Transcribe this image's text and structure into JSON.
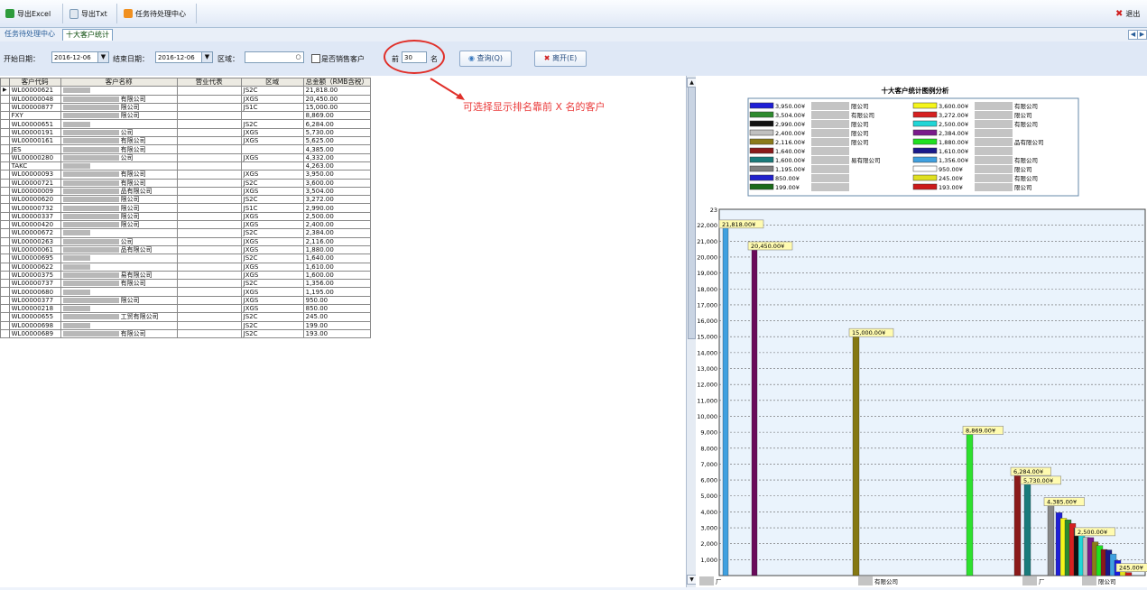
{
  "toolbar": {
    "export_excel": "导出Excel",
    "export_txt": "导出Txt",
    "task_center": "任务待处理中心",
    "exit": "退出"
  },
  "tabs": [
    {
      "label": "任务待处理中心"
    },
    {
      "label": "十大客户统计"
    }
  ],
  "filter": {
    "start_label": "开始日期：",
    "start_value": "2016-12-06",
    "end_label": "结束日期：",
    "end_value": "2016-12-06",
    "region_label": "区域：",
    "region_value": "",
    "checkbox_label": "是否销售客户",
    "top_label": "前",
    "top_value": "30",
    "top_suffix": "名",
    "query_button": "查询(Q)",
    "leave_button": "离开(E)"
  },
  "annotation": "可选择显示排名靠前 X 名的客户",
  "table": {
    "headers": [
      "客户代码",
      "客户名称",
      "营业代表",
      "区域",
      "总金额（RMB含税）"
    ],
    "rows": [
      {
        "code": "WL00000621",
        "name": "",
        "rep": "",
        "region": "JS2C",
        "total": "21,818.00"
      },
      {
        "code": "WL00000048",
        "name": "有限公司",
        "rep": "",
        "region": "JXGS",
        "total": "20,450.00"
      },
      {
        "code": "WL00000877",
        "name": "限公司",
        "rep": "",
        "region": "JS1C",
        "total": "15,000.00"
      },
      {
        "code": "FXY",
        "name": "限公司",
        "rep": "",
        "region": "",
        "total": "8,869.00"
      },
      {
        "code": "WL00000651",
        "name": "",
        "rep": "",
        "region": "JS2C",
        "total": "6,284.00"
      },
      {
        "code": "WL00000191",
        "name": "公司",
        "rep": "",
        "region": "JXGS",
        "total": "5,730.00"
      },
      {
        "code": "WL00000161",
        "name": "有限公司",
        "rep": "",
        "region": "JXGS",
        "total": "5,625.00"
      },
      {
        "code": "JES",
        "name": "有限公司",
        "rep": "",
        "region": "",
        "total": "4,385.00"
      },
      {
        "code": "WL00000280",
        "name": "公司",
        "rep": "",
        "region": "JXGS",
        "total": "4,332.00"
      },
      {
        "code": "TAKC",
        "name": "",
        "rep": "",
        "region": "",
        "total": "4,263.00"
      },
      {
        "code": "WL00000093",
        "name": "有限公司",
        "rep": "",
        "region": "JXGS",
        "total": "3,950.00"
      },
      {
        "code": "WL00000721",
        "name": "有限公司",
        "rep": "",
        "region": "JS2C",
        "total": "3,600.00"
      },
      {
        "code": "WL00000009",
        "name": "品有限公司",
        "rep": "",
        "region": "JXGS",
        "total": "3,504.00"
      },
      {
        "code": "WL00000620",
        "name": "限公司",
        "rep": "",
        "region": "JS2C",
        "total": "3,272.00"
      },
      {
        "code": "WL00000732",
        "name": "限公司",
        "rep": "",
        "region": "JS1C",
        "total": "2,990.00"
      },
      {
        "code": "WL00000337",
        "name": "限公司",
        "rep": "",
        "region": "JXGS",
        "total": "2,500.00"
      },
      {
        "code": "WL00000420",
        "name": "限公司",
        "rep": "",
        "region": "JXGS",
        "total": "2,400.00"
      },
      {
        "code": "WL00000672",
        "name": "",
        "rep": "",
        "region": "JS2C",
        "total": "2,384.00"
      },
      {
        "code": "WL00000263",
        "name": "公司",
        "rep": "",
        "region": "JXGS",
        "total": "2,116.00"
      },
      {
        "code": "WL00000061",
        "name": "品有限公司",
        "rep": "",
        "region": "JXGS",
        "total": "1,880.00"
      },
      {
        "code": "WL00000695",
        "name": "",
        "rep": "",
        "region": "JS2C",
        "total": "1,640.00"
      },
      {
        "code": "WL00000622",
        "name": "",
        "rep": "",
        "region": "JXGS",
        "total": "1,610.00"
      },
      {
        "code": "WL00000375",
        "name": "易有限公司",
        "rep": "",
        "region": "JXGS",
        "total": "1,600.00"
      },
      {
        "code": "WL00000737",
        "name": "有限公司",
        "rep": "",
        "region": "JS2C",
        "total": "1,356.00"
      },
      {
        "code": "WL00000680",
        "name": "",
        "rep": "",
        "region": "JXGS",
        "total": "1,195.00"
      },
      {
        "code": "WL00000377",
        "name": "限公司",
        "rep": "",
        "region": "JXGS",
        "total": "950.00"
      },
      {
        "code": "WL00000218",
        "name": "",
        "rep": "",
        "region": "JXGS",
        "total": "850.00"
      },
      {
        "code": "WL00000655",
        "name": "工贸有限公司",
        "rep": "",
        "region": "JS2C",
        "total": "245.00"
      },
      {
        "code": "WL00000698",
        "name": "",
        "rep": "",
        "region": "JS2C",
        "total": "199.00"
      },
      {
        "code": "WL00000689",
        "name": "有限公司",
        "rep": "",
        "region": "JS2C",
        "total": "193.00"
      }
    ]
  },
  "chart_data": {
    "type": "bar",
    "title": "十大客户统计图例分析",
    "ylim": [
      0,
      23000
    ],
    "yticks": [
      "1,000",
      "2,000",
      "3,000",
      "4,000",
      "5,000",
      "6,000",
      "7,000",
      "8,000",
      "9,000",
      "10,000",
      "11,000",
      "12,000",
      "13,000",
      "14,000",
      "15,000",
      "16,000",
      "17,000",
      "18,000",
      "19,000",
      "20,000",
      "21,000",
      "22,000"
    ],
    "ytop_label": "23",
    "grid": true,
    "legend_position": "top",
    "legend": [
      {
        "value": "3,950.00¥",
        "name": "限公司",
        "color": "#1f1fd6"
      },
      {
        "value": "3,504.00¥",
        "name": "有限公司",
        "color": "#2e8b2e"
      },
      {
        "value": "2,990.00¥",
        "name": "限公司",
        "color": "#111111"
      },
      {
        "value": "2,400.00¥",
        "name": "限公司",
        "color": "#c0c0c0"
      },
      {
        "value": "2,116.00¥",
        "name": "限公司",
        "color": "#8b7b1a"
      },
      {
        "value": "1,640.00¥",
        "name": "",
        "color": "#8b1a1a"
      },
      {
        "value": "1,600.00¥",
        "name": "易有限公司",
        "color": "#1a7b7b"
      },
      {
        "value": "1,195.00¥",
        "name": "",
        "color": "#808080"
      },
      {
        "value": "850.00¥",
        "name": "",
        "color": "#2222cc"
      },
      {
        "value": "199.00¥",
        "name": "",
        "color": "#1a6b1a"
      },
      {
        "value": "3,600.00¥",
        "name": "有限公司",
        "color": "#f5f51a"
      },
      {
        "value": "3,272.00¥",
        "name": "限公司",
        "color": "#d62020"
      },
      {
        "value": "2,500.00¥",
        "name": "有限公司",
        "color": "#20d6d6"
      },
      {
        "value": "2,384.00¥",
        "name": "",
        "color": "#7a1a8b"
      },
      {
        "value": "1,880.00¥",
        "name": "品有限公司",
        "color": "#20e020"
      },
      {
        "value": "1,610.00¥",
        "name": "",
        "color": "#1a1a8b"
      },
      {
        "value": "1,356.00¥",
        "name": "有限公司",
        "color": "#3fa0e0"
      },
      {
        "value": "950.00¥",
        "name": "限公司",
        "color": "#ffffff"
      },
      {
        "value": "245.00¥",
        "name": "有限公司",
        "color": "#e0e020"
      },
      {
        "value": "193.00¥",
        "name": "限公司",
        "color": "#cc1a1a"
      }
    ],
    "series": [
      {
        "value": 21818,
        "label": "21,818.00¥",
        "color": "#3fa0e0"
      },
      {
        "value": 20450,
        "label": "20,450.00¥",
        "color": "#6a0a5a"
      },
      {
        "value": 15000,
        "label": "15,000.00¥",
        "color": "#857812"
      },
      {
        "value": 8869,
        "label": "8,869.00¥",
        "color": "#2ee02e"
      },
      {
        "value": 6284,
        "label": "6,284.00¥",
        "color": "#8b1a1a"
      },
      {
        "value": 5730,
        "label": "5,730.00¥",
        "color": "#1a7b7b"
      },
      {
        "value": 4385,
        "label": "4,385.00¥",
        "color": "#888888"
      },
      {
        "value": 3950,
        "label": "",
        "color": "#1f1fd6"
      },
      {
        "value": 3600,
        "label": "",
        "color": "#f5f51a"
      },
      {
        "value": 3504,
        "label": "",
        "color": "#2e8b2e"
      },
      {
        "value": 3272,
        "label": "",
        "color": "#d62020"
      },
      {
        "value": 2990,
        "label": "",
        "color": "#111111"
      },
      {
        "value": 2500,
        "label": "2,500.00¥",
        "color": "#20d6d6"
      },
      {
        "value": 2400,
        "label": "",
        "color": "#c0c0c0"
      },
      {
        "value": 2384,
        "label": "",
        "color": "#7a1a8b"
      },
      {
        "value": 2116,
        "label": "",
        "color": "#8b7b1a"
      },
      {
        "value": 1880,
        "label": "",
        "color": "#20e020"
      },
      {
        "value": 1640,
        "label": "",
        "color": "#8b1a1a"
      },
      {
        "value": 1610,
        "label": "",
        "color": "#1a1a8b"
      },
      {
        "value": 1356,
        "label": "",
        "color": "#3fa0e0"
      },
      {
        "value": 950,
        "label": "",
        "color": "#1a1ae0"
      },
      {
        "value": 245,
        "label": "245.00¥",
        "color": "#e0e020"
      },
      {
        "value": 193,
        "label": "",
        "color": "#cc1a1a"
      }
    ],
    "xlabels": [
      "厂",
      "有限公司",
      "厂",
      "限公司"
    ]
  }
}
